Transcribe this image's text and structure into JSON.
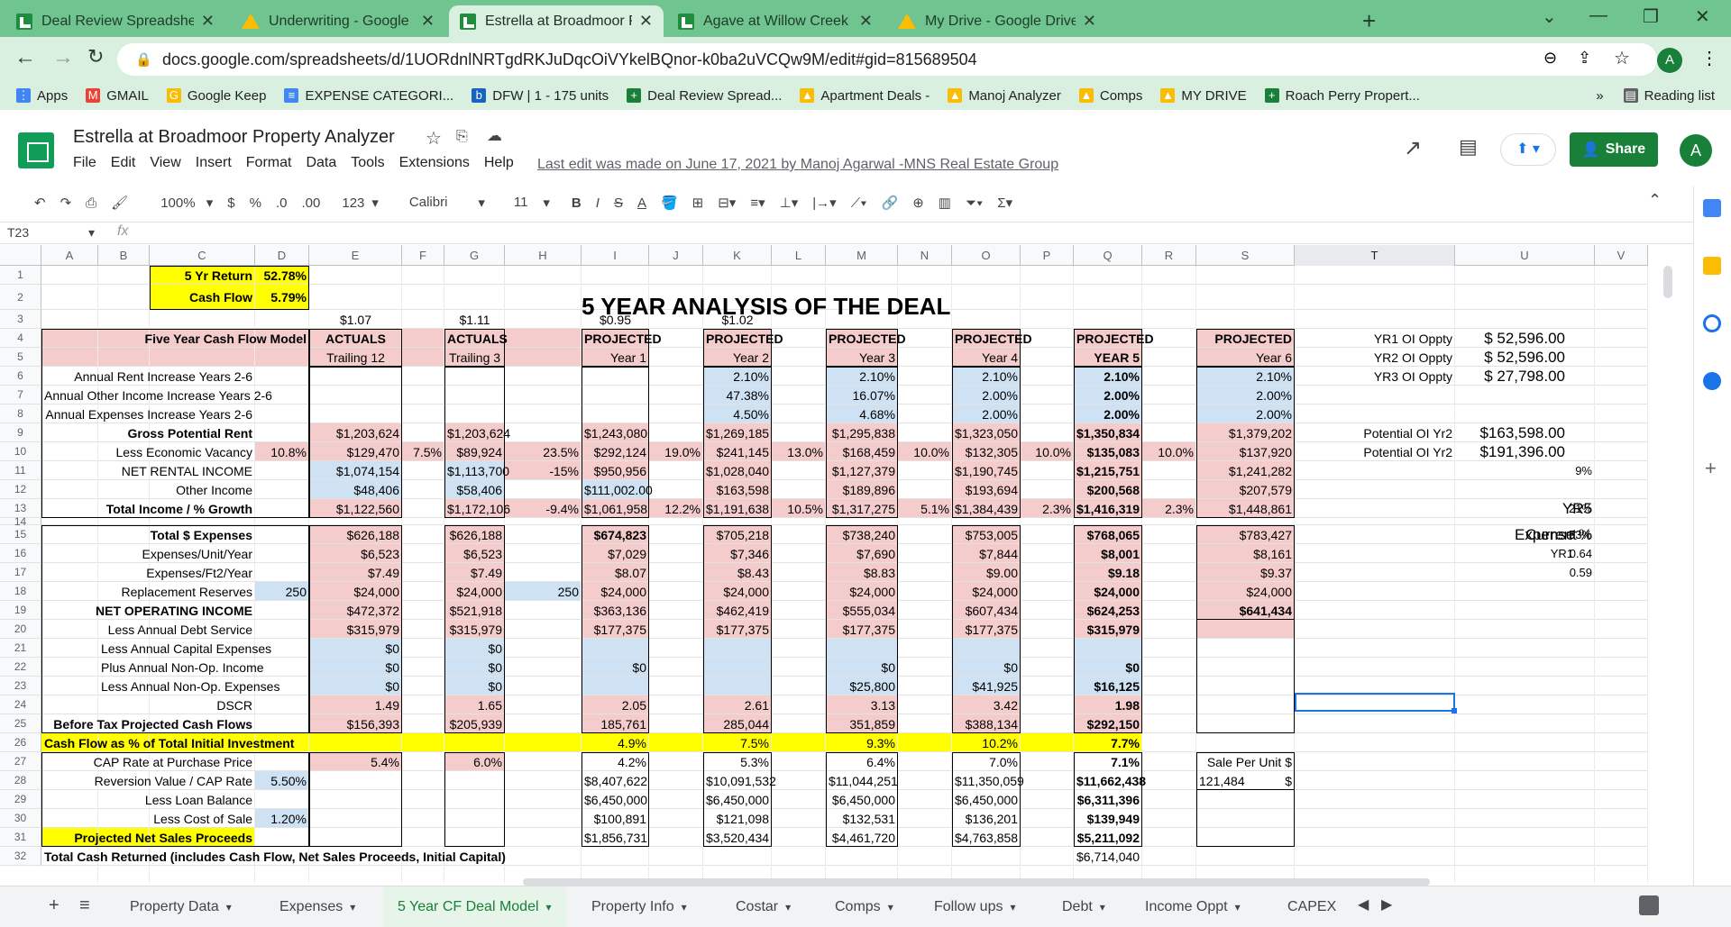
{
  "browser": {
    "tabs": [
      {
        "title": "Deal Review Spreadsheet - Goog",
        "icon": "sheets-icon"
      },
      {
        "title": "Underwriting - Google Drive",
        "icon": "drive-icon"
      },
      {
        "title": "Estrella at Broadmoor Property A",
        "icon": "sheets-icon"
      },
      {
        "title": "Agave at Willow Creek Property A",
        "icon": "sheets-icon"
      },
      {
        "title": "My Drive - Google Drive",
        "icon": "drive-icon"
      }
    ],
    "url": "docs.google.com/spreadsheets/d/1UORdnlNRTgdRKJuDqcOiVYkelBQnor-k0ba2uVCQw9M/edit#gid=815689504",
    "profile_initial": "A",
    "bookmarks": [
      "Apps",
      "GMAIL",
      "Google Keep",
      "EXPENSE CATEGORI...",
      "DFW | 1 - 175 units",
      "Deal Review Spread...",
      "Apartment Deals -",
      "Manoj Analyzer",
      "Comps",
      "MY DRIVE",
      "Roach Perry Propert..."
    ],
    "overflow": "»",
    "reading_list": "Reading list"
  },
  "doc": {
    "title": "Estrella at Broadmoor Property Analyzer",
    "menus": [
      "File",
      "Edit",
      "View",
      "Insert",
      "Format",
      "Data",
      "Tools",
      "Extensions",
      "Help"
    ],
    "last_edit": "Last edit was made on June 17, 2021 by Manoj Agarwal -MNS Real Estate Group",
    "share": "Share",
    "user_initial": "A"
  },
  "toolbar": {
    "zoom": "100%",
    "currency": "$",
    "percent": "%",
    "dec_less": ".0",
    "dec_more": ".00",
    "format_more": "123",
    "font": "Calibri",
    "size": "11",
    "bold": "B",
    "italic": "I",
    "strike": "S",
    "textcolor": "A"
  },
  "formula": {
    "cell_ref": "T23",
    "fx": "fx"
  },
  "columns": [
    "A",
    "B",
    "C",
    "D",
    "E",
    "F",
    "G",
    "H",
    "I",
    "J",
    "K",
    "L",
    "M",
    "N",
    "O",
    "P",
    "Q",
    "R",
    "S",
    "T",
    "U",
    "V"
  ],
  "rows": [
    "1",
    "2",
    "3",
    "4",
    "5",
    "6",
    "7",
    "8",
    "9",
    "10",
    "11",
    "12",
    "13",
    "14",
    "15",
    "16",
    "17",
    "18",
    "19",
    "20",
    "21",
    "22",
    "23",
    "24",
    "25",
    "26",
    "27",
    "28",
    "29",
    "30",
    "31",
    "32"
  ],
  "sheet": {
    "yr5_return_label": "5 Yr Return",
    "yr5_return": "52.78%",
    "cashflow_label": "Cash Flow",
    "cashflow": "5.79%",
    "heading": "5 YEAR ANALYSIS OF THE DEAL",
    "ppu": [
      "$1.07",
      "$1.11",
      "$0.95",
      "$1.02"
    ],
    "model_title": "Five Year Cash Flow Model",
    "col_heads": [
      [
        "ACTUALS",
        "Trailing 12"
      ],
      [
        "ACTUALS",
        "Trailing 3"
      ],
      [
        "PROJECTED",
        "Year 1"
      ],
      [
        "PROJECTED",
        "Year 2"
      ],
      [
        "PROJECTED",
        "Year 3"
      ],
      [
        "PROJECTED",
        "Year 4"
      ],
      [
        "PROJECTED",
        "YEAR 5"
      ],
      [
        "PROJECTED",
        "Year 6"
      ]
    ],
    "labels": {
      "6": "Annual Rent Increase Years 2-6",
      "7": "Annual Other Income Increase Years 2-6",
      "8": "Annual Expenses Increase Years 2-6",
      "9": "Gross Potential Rent",
      "10": "Less Economic Vacancy",
      "11": "NET RENTAL INCOME",
      "12": "Other Income",
      "13": "Total Income / % Growth",
      "15": "Total $ Expenses",
      "16": "Expenses/Unit/Year",
      "17": "Expenses/Ft2/Year",
      "18": "Replacement Reserves",
      "19": "NET OPERATING INCOME",
      "20": "Less Annual Debt Service",
      "21": "Less Annual Capital Expenses",
      "22": "Plus Annual Non-Op. Income",
      "23": "Less Annual Non-Op. Expenses",
      "24": "DSCR",
      "25": "Before Tax  Projected Cash Flows",
      "26": "Cash Flow as % of Total Initial Investment",
      "27": "CAP Rate at Purchase Price",
      "28": "Reversion Value  / CAP Rate",
      "29": "Less Loan Balance",
      "30": "Less Cost of Sale",
      "31": "Projected Net Sales Proceeds",
      "32": "Total Cash Returned (includes Cash Flow, Net Sales Proceeds, Initial Capital)"
    },
    "d": {
      "10": "10.8%",
      "18": "250",
      "28": "5.50%",
      "30": "1.20%"
    },
    "f": {
      "10": "7.5%"
    },
    "h": {
      "10": "23.5%",
      "11": "-15%",
      "13": "-9.4%",
      "18": "250"
    },
    "j": {
      "10": "19.0%",
      "13": "12.2%"
    },
    "l": {
      "10": "13.0%",
      "13": "10.5%"
    },
    "n": {
      "10": "10.0%",
      "13": "5.1%"
    },
    "p": {
      "10": "10.0%",
      "13": "2.3%"
    },
    "r": {
      "10": "10.0%",
      "13": "2.3%"
    },
    "E": {
      "9": "$1,203,624",
      "10": "$129,470",
      "11": "$1,074,154",
      "12": "$48,406",
      "13": "$1,122,560",
      "15": "$626,188",
      "16": "$6,523",
      "17": "$7.49",
      "18": "$24,000",
      "19": "$472,372",
      "20": "$315,979",
      "21": "$0",
      "22": "$0",
      "23": "$0",
      "24": "1.49",
      "25": "$156,393",
      "27": "5.4%"
    },
    "G": {
      "9": "$1,203,624",
      "10": "$89,924",
      "11": "$1,113,700",
      "12": "$58,406",
      "13": "$1,172,106",
      "15": "$626,188",
      "16": "$6,523",
      "17": "$7.49",
      "18": "$24,000",
      "19": "$521,918",
      "20": "$315,979",
      "21": "$0",
      "22": "$0",
      "23": "$0",
      "24": "1.65",
      "25": "$205,939",
      "27": "6.0%"
    },
    "I": {
      "9": "$1,243,080",
      "10": "$292,124",
      "11": "$950,956",
      "12": "$111,002.00",
      "13": "$1,061,958",
      "15": "$674,823",
      "16": "$7,029",
      "17": "$8.07",
      "18": "$24,000",
      "19": "$363,136",
      "20": "$177,375",
      "22": "$0",
      "24": "2.05",
      "25": "185,761",
      "26": "4.9%",
      "27": "4.2%",
      "28": "$8,407,622",
      "29": "$6,450,000",
      "30": "$100,891",
      "31": "$1,856,731"
    },
    "K": {
      "6": "2.10%",
      "7": "47.38%",
      "8": "4.50%",
      "9": "$1,269,185",
      "10": "$241,145",
      "11": "$1,028,040",
      "12": "$163,598",
      "13": "$1,191,638",
      "15": "$705,218",
      "16": "$7,346",
      "17": "$8.43",
      "18": "$24,000",
      "19": "$462,419",
      "20": "$177,375",
      "24": "2.61",
      "25": "285,044",
      "26": "7.5%",
      "27": "5.3%",
      "28": "$10,091,532",
      "29": "$6,450,000",
      "30": "$121,098",
      "31": "$3,520,434"
    },
    "M": {
      "6": "2.10%",
      "7": "16.07%",
      "8": "4.68%",
      "9": "$1,295,838",
      "10": "$168,459",
      "11": "$1,127,379",
      "12": "$189,896",
      "13": "$1,317,275",
      "15": "$738,240",
      "16": "$7,690",
      "17": "$8.83",
      "18": "$24,000",
      "19": "$555,034",
      "20": "$177,375",
      "22": "$0",
      "23": "$25,800",
      "24": "3.13",
      "25": "351,859",
      "26": "9.3%",
      "27": "6.4%",
      "28": "$11,044,251",
      "29": "$6,450,000",
      "30": "$132,531",
      "31": "$4,461,720"
    },
    "O": {
      "6": "2.10%",
      "7": "2.00%",
      "8": "2.00%",
      "9": "$1,323,050",
      "10": "$132,305",
      "11": "$1,190,745",
      "12": "$193,694",
      "13": "$1,384,439",
      "15": "$753,005",
      "16": "$7,844",
      "17": "$9.00",
      "18": "$24,000",
      "19": "$607,434",
      "20": "$177,375",
      "22": "$0",
      "23": "$41,925",
      "24": "3.42",
      "25": "$388,134",
      "26": "10.2%",
      "27": "7.0%",
      "28": "$11,350,059",
      "29": "$6,450,000",
      "30": "$136,201",
      "31": "$4,763,858"
    },
    "Q": {
      "6": "2.10%",
      "7": "2.00%",
      "8": "2.00%",
      "9": "$1,350,834",
      "10": "$135,083",
      "11": "$1,215,751",
      "12": "$200,568",
      "13": "$1,416,319",
      "15": "$768,065",
      "16": "$8,001",
      "17": "$9.18",
      "18": "$24,000",
      "19": "$624,253",
      "20": "$315,979",
      "22": "$0",
      "23": "$16,125",
      "24": "1.98",
      "25": "$292,150",
      "26": "7.7%",
      "27": "7.1%",
      "28": "$11,662,438",
      "29": "$6,311,396",
      "30": "$139,949",
      "31": "$5,211,092",
      "32": "$6,714,040"
    },
    "S": {
      "6": "2.10%",
      "7": "2.00%",
      "8": "2.00%",
      "9": "$1,379,202",
      "10": "$137,920",
      "11": "$1,241,282",
      "12": "$207,579",
      "13": "$1,448,861",
      "15": "$783,427",
      "16": "$8,161",
      "17": "$9.37",
      "18": "$24,000",
      "19": "$641,434",
      "27": "Sale Per Unit $",
      "28a": "$",
      "28b": "121,484"
    },
    "T": {
      "4": "YR1 OI Oppty",
      "5": "YR2 OI Oppty",
      "6": "YR3 OI Oppty",
      "9": "Potential OI Yr2",
      "10": "Potential OI Yr2"
    },
    "U": {
      "4": "$ 52,596.00",
      "5": "$ 52,596.00",
      "6": "$ 27,798.00",
      "9": "$163,598.00",
      "10": "$191,396.00",
      "11": "9%",
      "13a": "21%",
      "13b": "YR5",
      "15a": "53%",
      "15b": "Expense %",
      "16": "0.64",
      "17": "0.59"
    },
    "V": {
      "15": "Current",
      "16": "YR1"
    }
  },
  "sheet_tabs": [
    "Property Data",
    "Expenses",
    "5 Year CF Deal Model",
    "Property Info",
    "Costar",
    "Comps",
    "Follow ups",
    "Debt",
    "Income Oppt",
    "CAPEX"
  ],
  "colors": {
    "pink": "#f4cccc",
    "blue": "#cfe2f3",
    "yellow": "#ffff00",
    "green": "#188038"
  }
}
